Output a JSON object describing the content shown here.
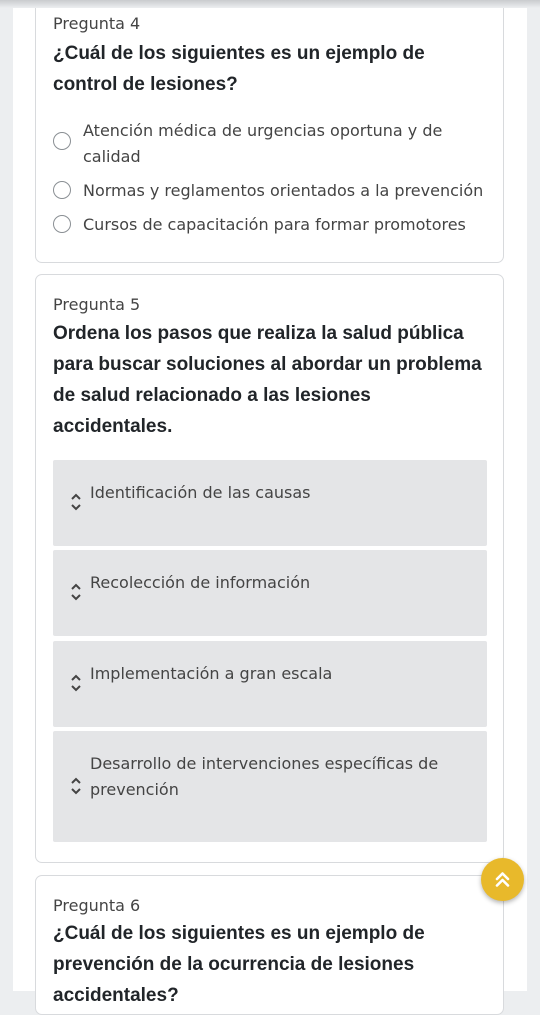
{
  "q4": {
    "label": "Pregunta 4",
    "text": "¿Cuál de los siguientes es un ejemplo de control de lesiones?",
    "options": [
      "Atención médica de urgencias oportuna y de calidad",
      "Normas y reglamentos orientados a la prevención",
      "Cursos de capacitación para formar promotores"
    ]
  },
  "q5": {
    "label": "Pregunta 5",
    "text": "Ordena los pasos que realiza la salud pública para buscar soluciones al abordar un problema de salud relacionado a las lesiones accidentales.",
    "items": [
      "Identificación de las causas",
      "Recolección de información",
      "Implementación a gran escala",
      "Desarrollo de intervenciones específicas de prevención"
    ]
  },
  "q6": {
    "label": "Pregunta 6",
    "text": "¿Cuál de los siguientes es un ejemplo de prevención de la ocurrencia de lesiones accidentales?"
  },
  "icons": {
    "radio": "radio-unchecked-icon",
    "sort": "sort-up-down-icon",
    "fab": "double-chevron-up-icon"
  },
  "colors": {
    "accent": "#e8b92b",
    "sort_bg": "#e4e5e7",
    "page_bg": "#eceef0"
  }
}
